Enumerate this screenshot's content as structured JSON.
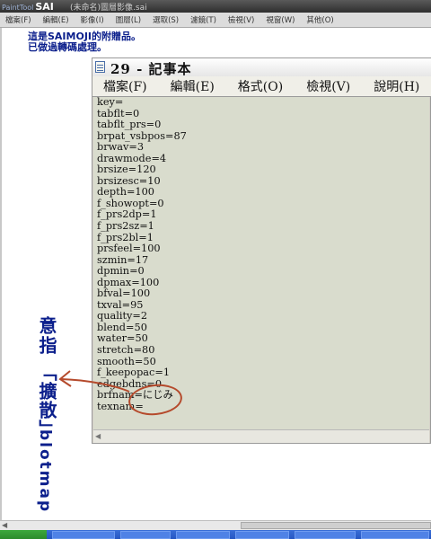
{
  "app": {
    "logo_small": "PaintTool",
    "logo_big": "SAI",
    "title": "(未命名)圖層影像.sai"
  },
  "menubar": [
    "檔案(F)",
    "編輯(E)",
    "影像(I)",
    "圖層(L)",
    "選取(S)",
    "濾鏡(T)",
    "檢視(V)",
    "視窗(W)",
    "其他(O)"
  ],
  "intro": {
    "line1": "這是SAIMOJI的附贈品。",
    "line2": "已做過轉碼處理。"
  },
  "notepad": {
    "title": "29 - 記事本",
    "menus": [
      "檔案(F)",
      "編輯(E)",
      "格式(O)",
      "檢視(V)",
      "說明(H)"
    ],
    "lines": [
      "key=",
      "tabflt=0",
      "tabflt_prs=0",
      "brpat_vsbpos=87",
      "brwav=3",
      "drawmode=4",
      "brsize=120",
      "brsizesc=10",
      "depth=100",
      "f_showopt=0",
      "f_prs2dp=1",
      "f_prs2sz=1",
      "f_prs2bl=1",
      "prsfeel=100",
      "szmin=17",
      "dpmin=0",
      "dpmax=100",
      "bfval=100",
      "txval=95",
      "quality=2",
      "blend=50",
      "water=50",
      "stretch=80",
      "smooth=50",
      "f_keepopac=1",
      "edgebdns=0",
      "brfnam=にじみ",
      "texnam="
    ]
  },
  "annotation": {
    "v1": "意指",
    "v2": "「擴散」",
    "v3": "blotmap"
  },
  "colors": {
    "annotation_text": "#0b1f8c",
    "annotation_mark": "#b54a2c",
    "editor_bg": "#d9dccd"
  }
}
